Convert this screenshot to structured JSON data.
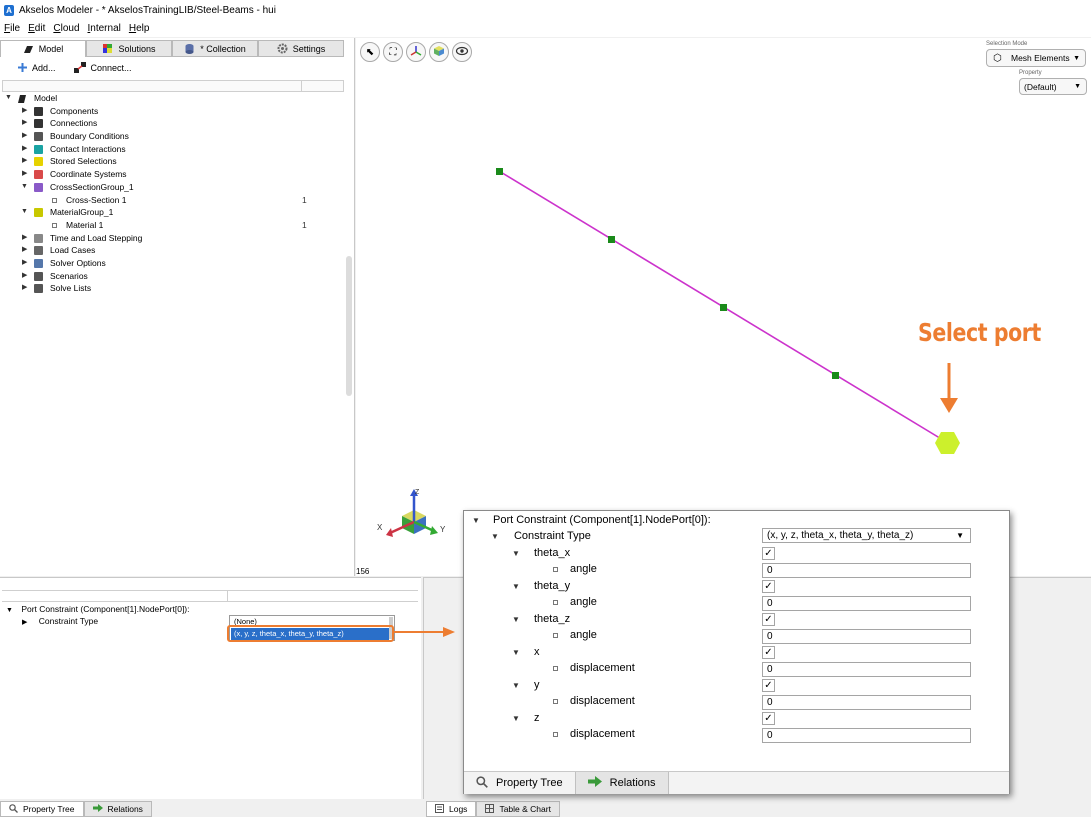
{
  "window": {
    "title": "Akselos Modeler - * AkselosTrainingLIB/Steel-Beams - hui"
  },
  "menu": [
    "File",
    "Edit",
    "Cloud",
    "Internal",
    "Help"
  ],
  "tabs": [
    "Model",
    "Solutions",
    "* Collection",
    "Settings"
  ],
  "toolbar": {
    "add_label": "Add...",
    "connect_label": "Connect..."
  },
  "tree": {
    "root": "Model",
    "items": [
      {
        "label": "Components",
        "level": 1,
        "expand": "right",
        "icon": "component-icon",
        "color": "#333333"
      },
      {
        "label": "Connections",
        "level": 1,
        "expand": "right",
        "icon": "connection-icon",
        "color": "#333333"
      },
      {
        "label": "Boundary Conditions",
        "level": 1,
        "expand": "right",
        "icon": "lock-icon",
        "color": "#555555"
      },
      {
        "label": "Contact Interactions",
        "level": 1,
        "expand": "right",
        "icon": "contact-icon",
        "color": "#1aa3a3"
      },
      {
        "label": "Stored Selections",
        "level": 1,
        "expand": "right",
        "icon": "selection-icon",
        "color": "#e6d200"
      },
      {
        "label": "Coordinate Systems",
        "level": 1,
        "expand": "right",
        "icon": "axes-icon",
        "color": "#d94a4a"
      },
      {
        "label": "CrossSectionGroup_1",
        "level": 1,
        "expand": "down",
        "icon": "cross-section-icon",
        "color": "#8a5ac8"
      },
      {
        "label": "Cross-Section 1",
        "level": 2,
        "expand": "none",
        "icon": "bullet-icon",
        "count": "1"
      },
      {
        "label": "MaterialGroup_1",
        "level": 1,
        "expand": "down",
        "icon": "material-icon",
        "color": "#c8c800"
      },
      {
        "label": "Material 1",
        "level": 2,
        "expand": "none",
        "icon": "bullet-icon",
        "count": "1"
      },
      {
        "label": "Time and Load Stepping",
        "level": 1,
        "expand": "right",
        "icon": "clock-icon",
        "color": "#888888"
      },
      {
        "label": "Load Cases",
        "level": 1,
        "expand": "right",
        "icon": "load-icon",
        "color": "#666666"
      },
      {
        "label": "Solver Options",
        "level": 1,
        "expand": "right",
        "icon": "solver-icon",
        "color": "#5577aa"
      },
      {
        "label": "Scenarios",
        "level": 1,
        "expand": "right",
        "icon": "scenario-icon",
        "color": "#555555"
      },
      {
        "label": "Solve Lists",
        "level": 1,
        "expand": "right",
        "icon": "solve-list-icon",
        "color": "#555555"
      }
    ]
  },
  "viewport": {
    "selection_mode_label": "Selection Mode",
    "selection_mode_value": "Mesh Elements",
    "property_label": "Property",
    "property_value": "(Default)",
    "fps": "156",
    "annotation": "Select port",
    "axis_labels": {
      "x": "X",
      "y": "Y",
      "z": "Z"
    },
    "colors": {
      "beam": "#cc33cc",
      "node": "#1a8a1a",
      "port": "#ccf02c",
      "annotation": "#ed7d31"
    }
  },
  "property_panel": {
    "title": "Port Constraint (Component[1].NodePort[0]):",
    "constraint_label": "Constraint Type",
    "options": [
      "(None)",
      "(x, y, z, theta_x, theta_y, theta_z)"
    ]
  },
  "zoom_panel": {
    "title": "Port Constraint (Component[1].NodePort[0]):",
    "constraint_label": "Constraint Type",
    "constraint_value": "(x, y, z, theta_x, theta_y, theta_z)",
    "groups": [
      {
        "name": "theta_x",
        "child": "angle",
        "checked": true,
        "value": "0"
      },
      {
        "name": "theta_y",
        "child": "angle",
        "checked": true,
        "value": "0"
      },
      {
        "name": "theta_z",
        "child": "angle",
        "checked": true,
        "value": "0"
      },
      {
        "name": "x",
        "child": "displacement",
        "checked": true,
        "value": "0"
      },
      {
        "name": "y",
        "child": "displacement",
        "checked": true,
        "value": "0"
      },
      {
        "name": "z",
        "child": "displacement",
        "checked": true,
        "value": "0"
      }
    ],
    "tabs": [
      "Property Tree",
      "Relations"
    ]
  },
  "bottom_tabs_left": [
    "Property Tree",
    "Relations"
  ],
  "bottom_tabs_right": [
    "Logs",
    "Table & Chart"
  ]
}
